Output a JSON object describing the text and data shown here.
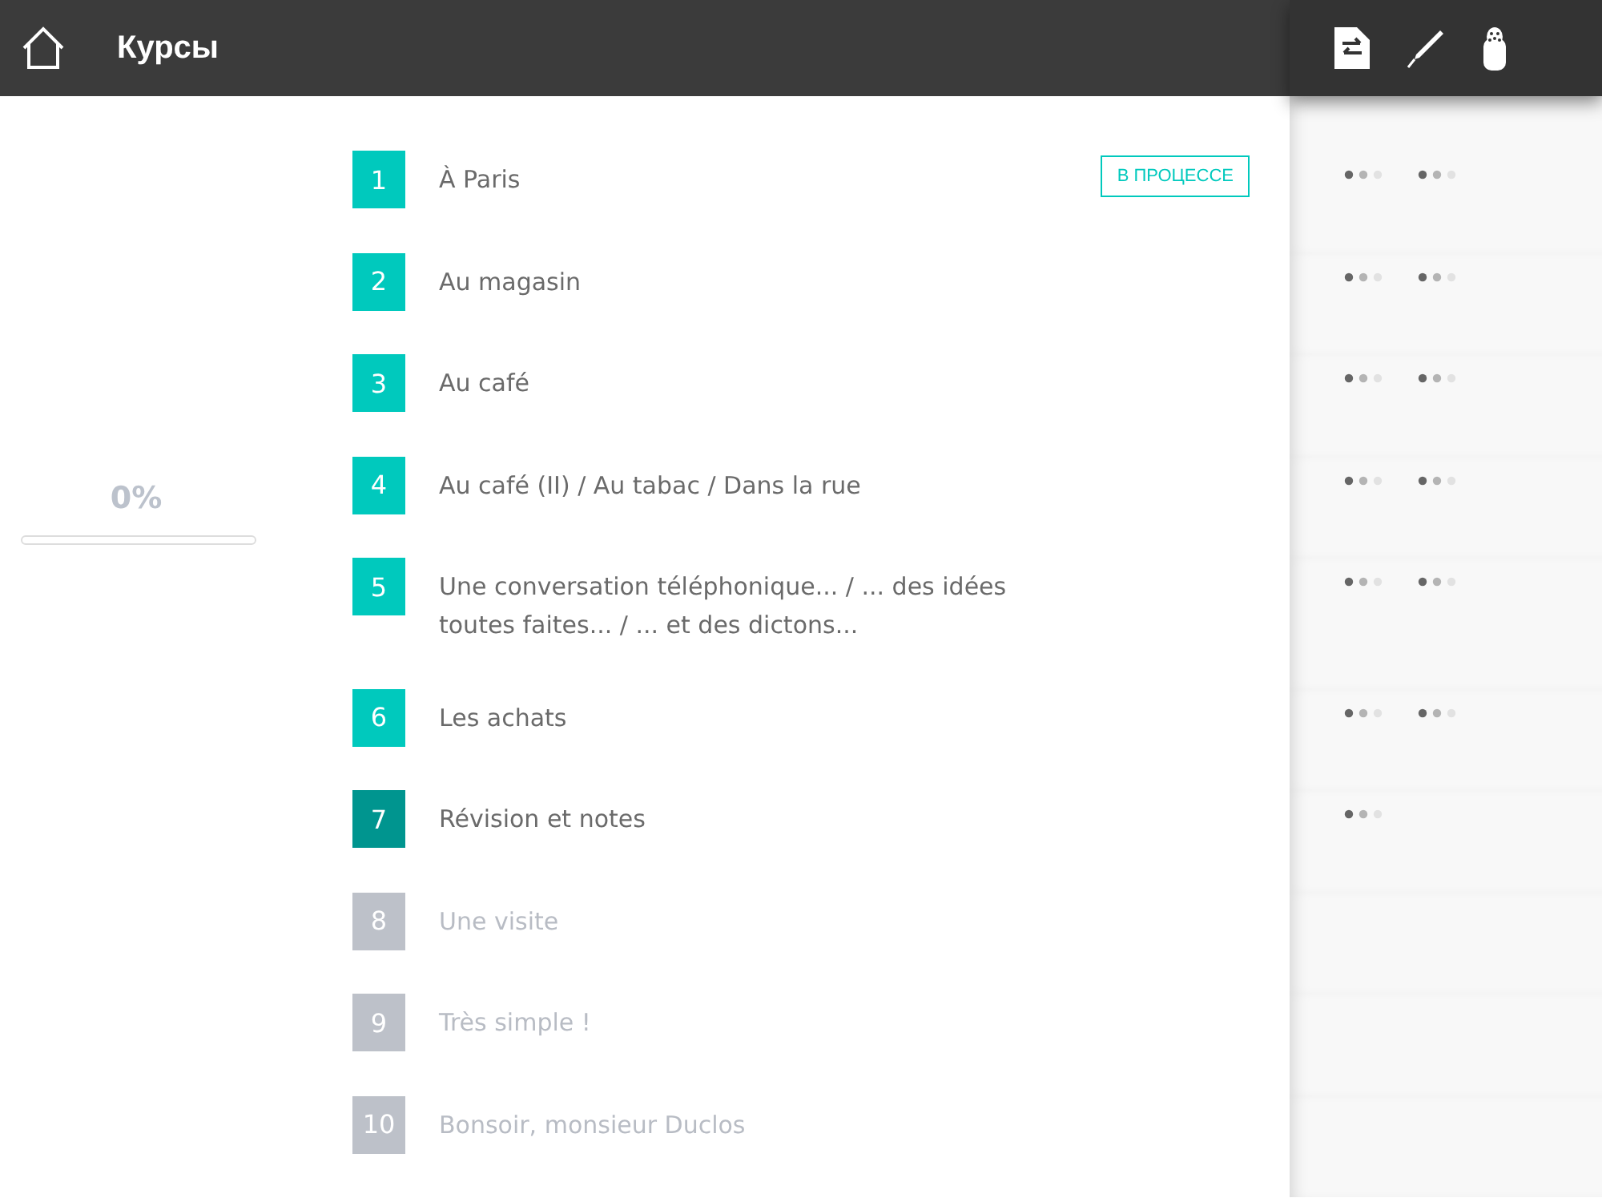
{
  "header": {
    "title": "Курсы"
  },
  "progress": {
    "label": "0%",
    "level": 0
  },
  "lessons": [
    {
      "number": "1",
      "title": "À Paris",
      "kind": "open",
      "badge": "В ПРОЦЕССЕ",
      "dot_groups": [
        {
          "kind": "pending"
        },
        {
          "kind": "pending"
        }
      ]
    },
    {
      "number": "2",
      "title": "Au magasin",
      "kind": "open",
      "dot_groups": [
        {
          "kind": "pending"
        },
        {
          "kind": "pending"
        }
      ]
    },
    {
      "number": "3",
      "title": "Au café",
      "kind": "open",
      "dot_groups": [
        {
          "kind": "pending"
        },
        {
          "kind": "pending"
        }
      ]
    },
    {
      "number": "4",
      "title": "Au café (II) / Au tabac / Dans la rue",
      "kind": "open",
      "dot_groups": [
        {
          "kind": "pending"
        },
        {
          "kind": "pending"
        }
      ]
    },
    {
      "number": "5",
      "title": "Une conversation téléphonique... / ... des idées toutes faites... / ... et des dictons...",
      "kind": "open",
      "dot_groups": [
        {
          "kind": "pending"
        },
        {
          "kind": "pending"
        }
      ]
    },
    {
      "number": "6",
      "title": "Les achats",
      "kind": "open",
      "dot_groups": [
        {
          "kind": "pending"
        },
        {
          "kind": "pending"
        }
      ]
    },
    {
      "number": "7",
      "title": "Révision et notes",
      "kind": "revision",
      "dot_groups": [
        {
          "kind": "pending"
        }
      ]
    },
    {
      "number": "8",
      "title": "Une visite",
      "kind": "locked"
    },
    {
      "number": "9",
      "title": "Très simple !",
      "kind": "locked"
    },
    {
      "number": "10",
      "title": "Bonsoir, monsieur Duclos",
      "kind": "locked"
    }
  ]
}
